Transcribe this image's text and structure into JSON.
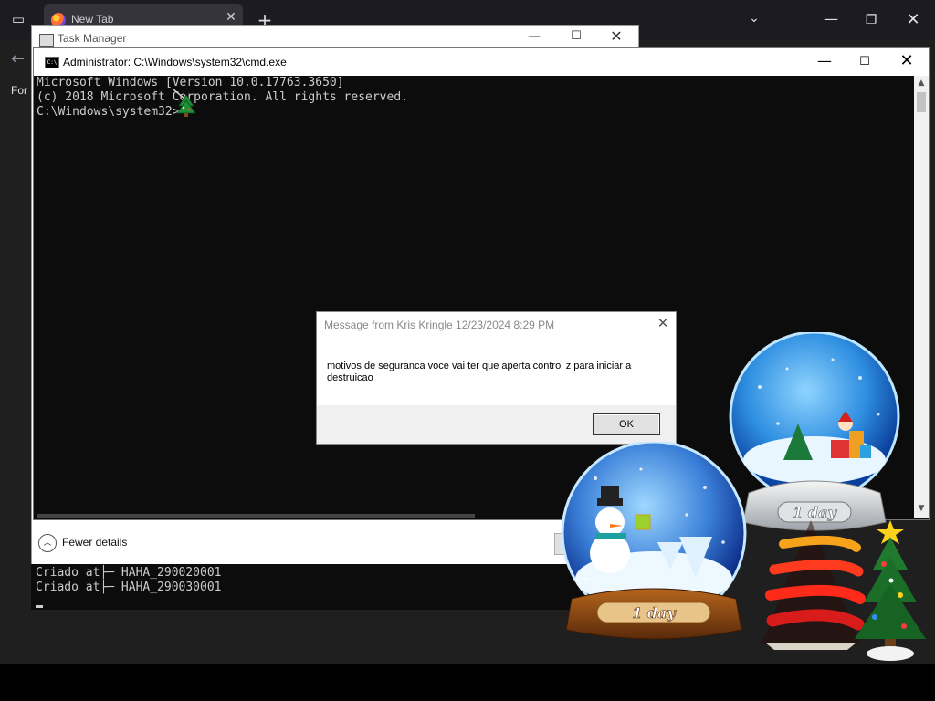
{
  "browser": {
    "tab_title": "New Tab",
    "for_text": "For"
  },
  "taskmanager": {
    "title": "Task Manager",
    "fewer_details": "Fewer details"
  },
  "cmd": {
    "title": "Administrator: C:\\Windows\\system32\\cmd.exe",
    "lines": [
      "Microsoft Windows [Version 10.0.17763.3650]",
      "(c) 2018 Microsoft Corporation. All rights reserved.",
      "",
      "C:\\Windows\\system32>"
    ]
  },
  "console2": {
    "lines": [
      "Criado at├─ HAHA_290020001",
      "Criado at├─ HAHA_290030001"
    ]
  },
  "msgbox": {
    "title": "Message from Kris Kringle 12/23/2024 8:29 PM",
    "text": "motivos de seguranca voce vai ter que aperta control z para iniciar a destruicao",
    "ok_label": "OK"
  },
  "decorations": {
    "globe1_label": "1 day",
    "globe2_label": "1 day"
  },
  "icons": [
    "sidebar-icon",
    "back-arrow-icon",
    "firefox-icon",
    "close-icon",
    "plus-icon",
    "chevron-down-icon",
    "minimize-icon",
    "maximize-icon",
    "task-manager-icon",
    "cmd-icon",
    "chevron-up-icon",
    "christmas-tree-cursor-icon"
  ]
}
